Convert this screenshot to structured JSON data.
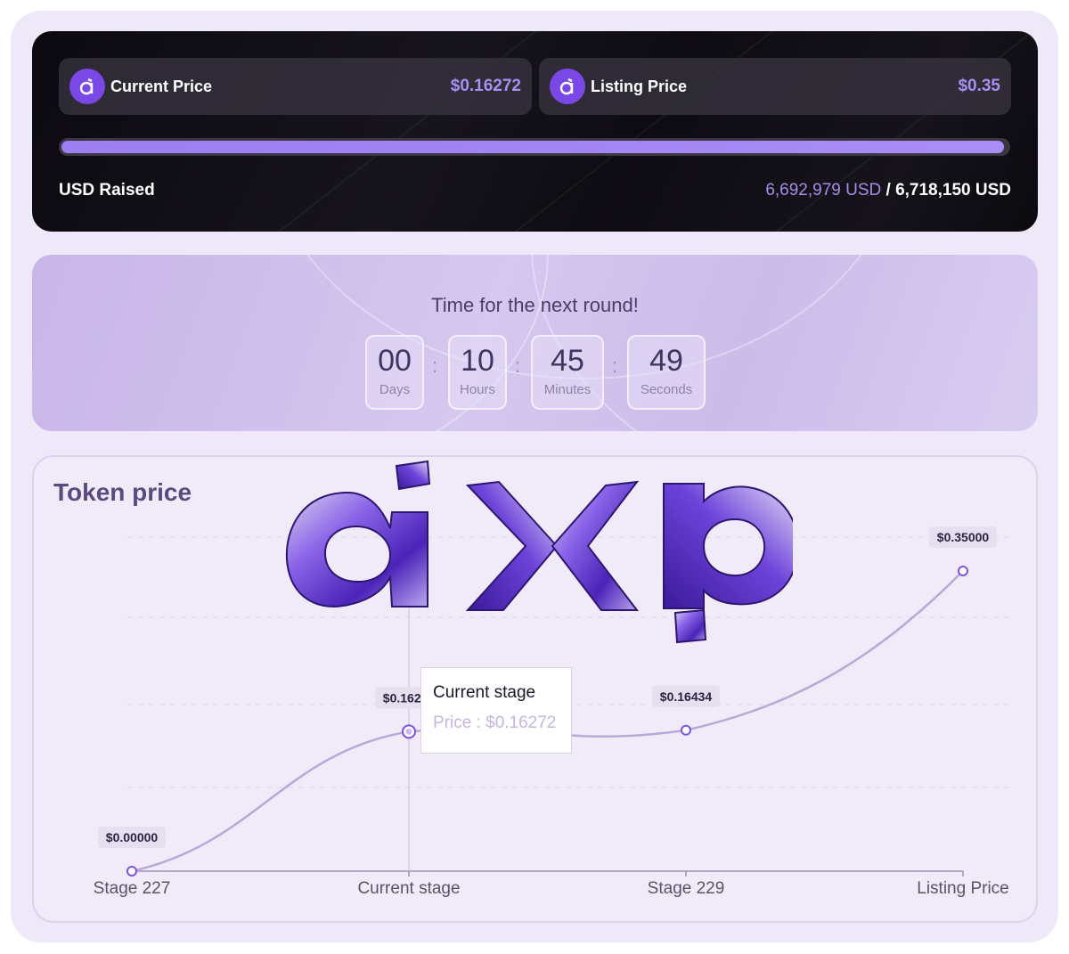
{
  "prices": {
    "current_label": "Current Price",
    "current_value": "$0.16272",
    "listing_label": "Listing Price",
    "listing_value": "$0.35"
  },
  "raised": {
    "label": "USD Raised",
    "amount": "6,692,979 USD",
    "separator": "/",
    "target": "6,718,150 USD",
    "progress_fraction": 0.9963
  },
  "countdown": {
    "title": "Time for the next round!",
    "units": [
      {
        "value": "00",
        "label": "Days"
      },
      {
        "value": "10",
        "label": "Hours"
      },
      {
        "value": "45",
        "label": "Minutes"
      },
      {
        "value": "49",
        "label": "Seconds"
      }
    ]
  },
  "token_chart": {
    "title": "Token price",
    "logo_text": "axp",
    "tooltip": {
      "title": "Current stage",
      "price": "Price : $0.16272"
    }
  },
  "chart_data": {
    "type": "line",
    "title": "Token price",
    "categories": [
      "Stage 227",
      "Current stage",
      "Stage 229",
      "Listing Price"
    ],
    "series": [
      {
        "values": [
          0.0,
          0.16272,
          0.16434,
          0.35
        ]
      }
    ],
    "data_labels": [
      "$0.00000",
      "$0.16272",
      "$0.16434",
      "$0.35000"
    ],
    "highlighted_category": "Current stage",
    "grid": true,
    "colors": {
      "line": "#b7a8d8",
      "point": "#7b52e0"
    }
  }
}
